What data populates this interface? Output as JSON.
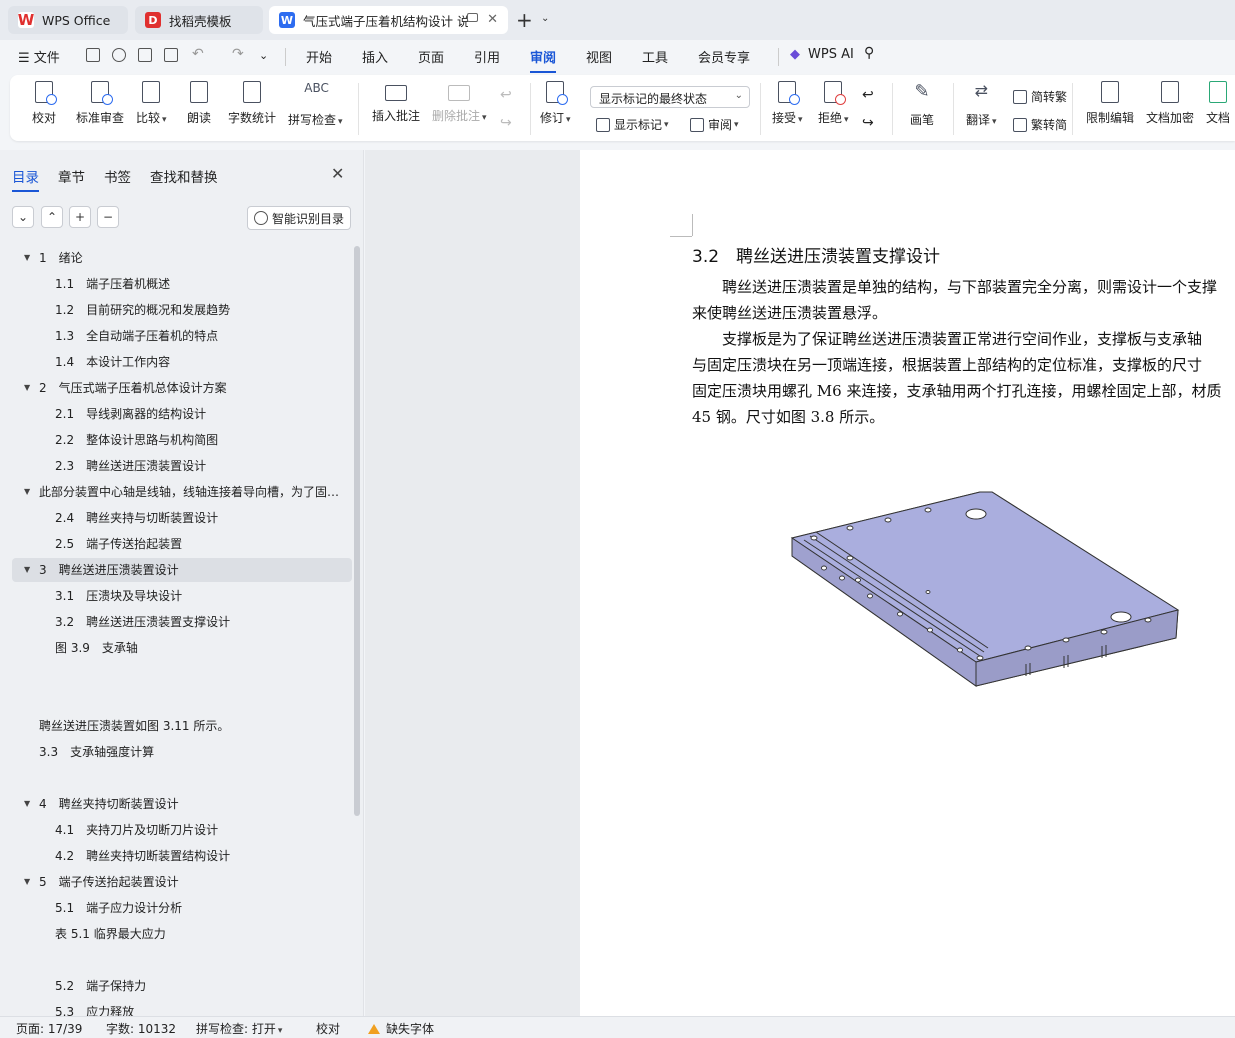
{
  "tabs": [
    {
      "label": "WPS Office",
      "icon": "wps-logo-icon"
    },
    {
      "label": "找稻壳模板",
      "icon": "docer-icon"
    },
    {
      "label": "气压式端子压着机结构设计 说",
      "icon": "word-doc-icon"
    }
  ],
  "menu": {
    "file": "文件",
    "items": [
      "开始",
      "插入",
      "页面",
      "引用",
      "审阅",
      "视图",
      "工具",
      "会员专享"
    ],
    "active": "审阅",
    "wps_ai": "WPS AI"
  },
  "ribbon": {
    "proofread": "校对",
    "standard_review": "标准审查",
    "compare": "比较",
    "read_aloud": "朗读",
    "word_count": "字数统计",
    "spell_check": "拼写检查",
    "insert_comment": "插入批注",
    "delete_comment": "删除批注",
    "revise": "修订",
    "markup_select": "显示标记的最终状态",
    "show_markup": "显示标记",
    "review": "审阅",
    "accept": "接受",
    "reject": "拒绝",
    "pen": "画笔",
    "translate": "翻译",
    "trad": "简转繁",
    "simp": "繁转简",
    "restrict_edit": "限制编辑",
    "encrypt": "文档加密",
    "doc_more": "文档"
  },
  "nav": {
    "tabs": [
      "目录",
      "章节",
      "书签",
      "查找和替换"
    ],
    "smart_toc": "智能识别目录",
    "items": [
      {
        "text": "1　绪论",
        "level": 1,
        "expanded": true
      },
      {
        "text": "1.1　端子压着机概述",
        "level": 2
      },
      {
        "text": "1.2　目前研究的概况和发展趋势",
        "level": 2
      },
      {
        "text": "1.3　全自动端子压着机的特点",
        "level": 2
      },
      {
        "text": "1.4　本设计工作内容",
        "level": 2
      },
      {
        "text": "2　气压式端子压着机总体设计方案",
        "level": 1,
        "expanded": true
      },
      {
        "text": "2.1　导线剥离器的结构设计",
        "level": 2
      },
      {
        "text": "2.2　整体设计思路与机构简图",
        "level": 2
      },
      {
        "text": "2.3　聘丝送进压溃装置设计",
        "level": 2
      },
      {
        "text": "此部分装置中心轴是线轴，线轴连接着导向槽，为了固…",
        "level": 0,
        "expanded": true
      },
      {
        "text": "2.4　聘丝夹持与切断装置设计",
        "level": 2
      },
      {
        "text": "2.5　端子传送抬起装置",
        "level": 2
      },
      {
        "text": "3　聘丝送进压溃装置设计",
        "level": 1,
        "expanded": true,
        "selected": true
      },
      {
        "text": "3.1　压溃块及导块设计",
        "level": 2
      },
      {
        "text": "3.2　聘丝送进压溃装置支撑设计",
        "level": 2
      },
      {
        "text": "图 3.9　支承轴",
        "level": 2
      },
      {
        "text": "",
        "level": 2
      },
      {
        "text": "",
        "level": 2
      },
      {
        "text": "聘丝送进压溃装置如图 3.11 所示。",
        "level": 0
      },
      {
        "text": "3.3　支承轴强度计算",
        "level": 0
      },
      {
        "text": "",
        "level": 2
      },
      {
        "text": "4　聘丝夹持切断装置设计",
        "level": 1,
        "expanded": true
      },
      {
        "text": "4.1　夹持刀片及切断刀片设计",
        "level": 2
      },
      {
        "text": "4.2　聘丝夹持切断装置结构设计",
        "level": 2
      },
      {
        "text": "5　端子传送抬起装置设计",
        "level": 1,
        "expanded": true
      },
      {
        "text": "5.1　端子应力设计分析",
        "level": 2
      },
      {
        "text": "表 5.1 临界最大应力",
        "level": 2
      },
      {
        "text": "",
        "level": 2
      },
      {
        "text": "5.2　端子保持力",
        "level": 2
      },
      {
        "text": "5.3　应力释放",
        "level": 2
      }
    ]
  },
  "document": {
    "heading": "3.2　聘丝送进压溃装置支撑设计",
    "p1_l1": "　　聘丝送进压溃装置是单独的结构，与下部装置完全分离，则需设计一个支撑",
    "p1_l2": "来使聘丝送进压溃装置悬浮。",
    "p2_l1": "　　支撑板是为了保证聘丝送进压溃装置正常进行空间作业，支撑板与支承轴",
    "p2_l2": "与固定压溃块在另一顶端连接，根据装置上部结构的定位标准，支撑板的尺寸",
    "p2_l3": "固定压溃块用螺孔 M6 来连接，支承轴用两个打孔连接，用螺栓固定上部，材质",
    "p2_l4": "45 钢。尺寸如图 3.8 所示。"
  },
  "status": {
    "page": "页面: 17/39",
    "words": "字数: 10132",
    "spell": "拼写检查: 打开",
    "proof": "校对",
    "missing_font": "缺失字体"
  },
  "colors": {
    "accent": "#1a56d6",
    "plate": "#a9abd6"
  }
}
